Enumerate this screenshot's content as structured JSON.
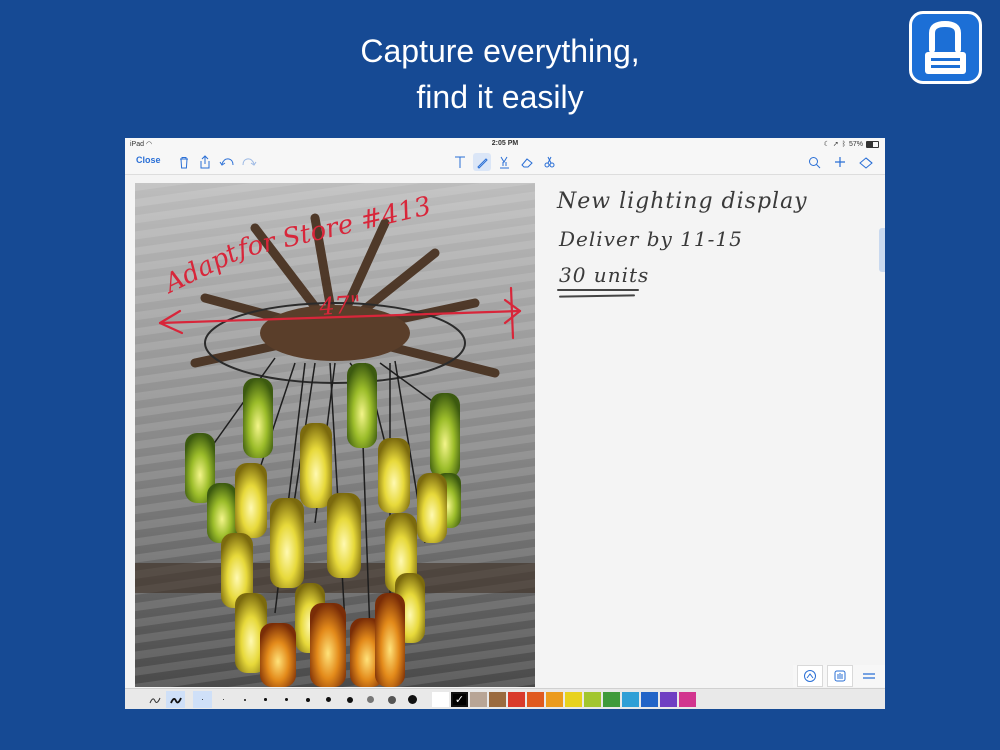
{
  "headline": {
    "line1": "Capture everything,",
    "line2": "find it easily"
  },
  "status_bar": {
    "device": "iPad",
    "time": "2:05 PM",
    "battery": "57%"
  },
  "toolbar": {
    "close_label": "Close",
    "left_icons": [
      "trash-icon",
      "share-icon",
      "undo-icon",
      "redo-icon"
    ],
    "center_tools": [
      "text-tool-icon",
      "pen-tool-icon",
      "highlighter-tool-icon",
      "eraser-tool-icon",
      "lasso-tool-icon"
    ],
    "active_tool": "pen-tool-icon",
    "right_icons": [
      "search-icon",
      "add-icon",
      "pages-icon"
    ]
  },
  "annotation": {
    "line1": "Adapt",
    "line2": "for Store #413",
    "measure": "47\""
  },
  "note": {
    "line1": "New lighting display",
    "line2": "Deliver by 11-15",
    "line3": "30 units"
  },
  "palette": {
    "pens": [
      "pen-style-1",
      "pen-style-2"
    ],
    "stroke_sizes": [
      1,
      1.5,
      2,
      2.5,
      3,
      4,
      5,
      6,
      7,
      8,
      9
    ],
    "colors": [
      "#ffffff",
      "#000000",
      "#b8a596",
      "#9b6b3f",
      "#d93a2b",
      "#e05a1f",
      "#ec9b1d",
      "#e8d21d",
      "#a2c62f",
      "#3f9a3a",
      "#2f9fd6",
      "#2264c7",
      "#6f3fc2",
      "#d2358f"
    ],
    "selected_color": "#000000"
  },
  "colors": {
    "brand_blue": "#164a94",
    "accent": "#2a6fd6",
    "ink_red": "#d8263a"
  }
}
